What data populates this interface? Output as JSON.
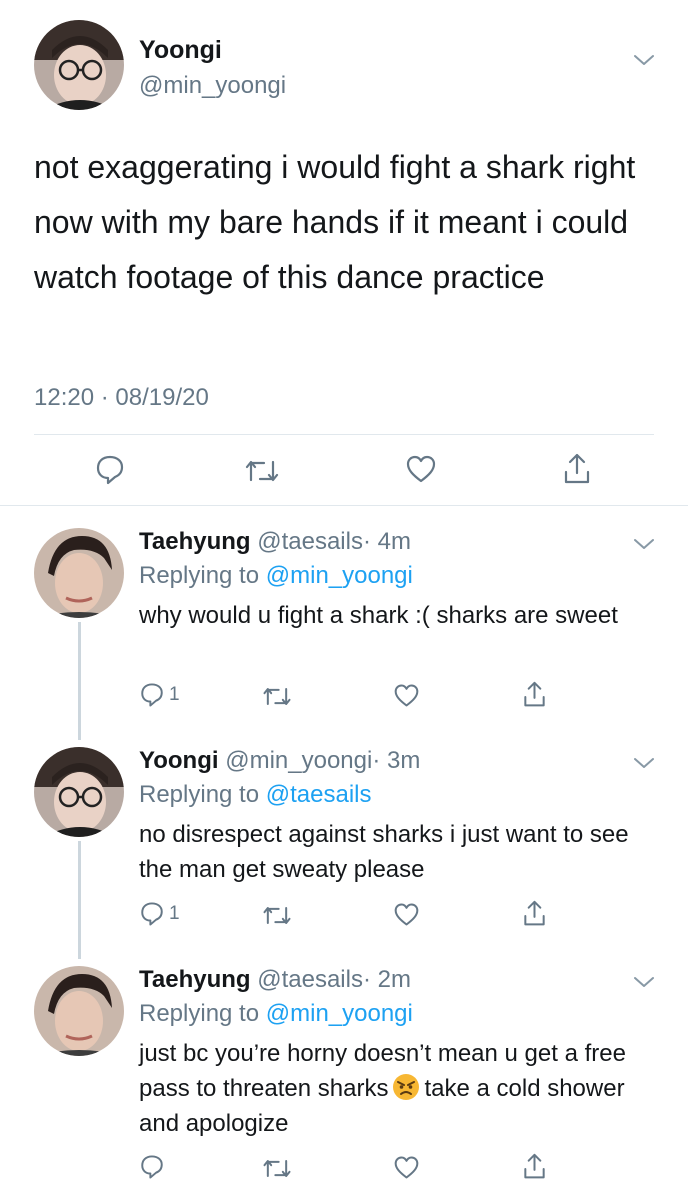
{
  "main_tweet": {
    "author_name": "Yoongi",
    "author_handle": "@min_yoongi",
    "text": "not exaggerating i would fight a shark right now with my bare hands if it meant i could watch footage of this dance practice",
    "timestamp": "12:20 · 08/19/20"
  },
  "replies": [
    {
      "author_name": "Taehyung",
      "author_handle": "@taesails",
      "time_ago": "· 4m",
      "replying_prefix": "Replying to ",
      "replying_to": "@min_yoongi",
      "text": "why would u fight a shark :( sharks are sweet",
      "reply_count": "1"
    },
    {
      "author_name": "Yoongi",
      "author_handle": "@min_yoongi",
      "time_ago": "· 3m",
      "replying_prefix": "Replying to ",
      "replying_to": "@taesails",
      "text": "no disrespect against sharks i just want to see the man get sweaty please",
      "reply_count": "1"
    },
    {
      "author_name": "Taehyung",
      "author_handle": "@taesails",
      "time_ago": "· 2m",
      "replying_prefix": "Replying to ",
      "replying_to": "@min_yoongi",
      "text_before_emoji": "just bc you’re horny doesn’t mean u get a free pass to threaten sharks",
      "emoji": "angry-face",
      "text_after_emoji": "take a cold shower and apologize",
      "reply_count": ""
    }
  ],
  "icons": {
    "reply": "speech-bubble-icon",
    "retweet": "retweet-icon",
    "like": "heart-icon",
    "share": "share-icon",
    "more": "chevron-down-icon"
  },
  "colors": {
    "text": "#14171a",
    "secondary": "#657786",
    "mention": "#1da1f2",
    "divider": "#e1e8ed",
    "thread_line": "#ccd6dd"
  }
}
